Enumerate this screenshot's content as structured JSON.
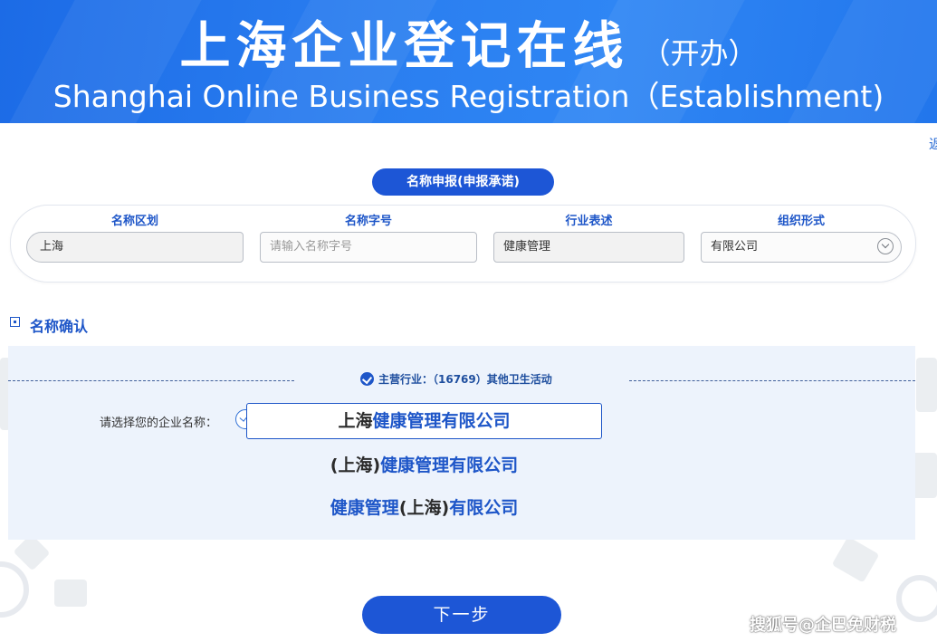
{
  "banner": {
    "title_cn": "上海企业登记在线",
    "title_cn_suffix": "（开办）",
    "title_en": "Shanghai Online Business Registration（Establishment)"
  },
  "edge_link": "返",
  "name_application": {
    "title": "名称申报(申报承诺)",
    "fields": [
      {
        "label": "名称区划",
        "value": "上海"
      },
      {
        "label": "名称字号",
        "placeholder": "请输入名称字号",
        "value": ""
      },
      {
        "label": "行业表述",
        "value": "健康管理"
      },
      {
        "label": "组织形式",
        "value": "有限公司"
      }
    ]
  },
  "name_confirm": {
    "title": "名称确认",
    "industry": "主营行业：（16769）其他卫生活动",
    "choose_label": "请选择您的企业名称：",
    "options": [
      {
        "parts": [
          {
            "text": "上海",
            "style": "dark"
          },
          {
            "text": "健康管理有限公司",
            "style": "blue"
          }
        ],
        "selected": true
      },
      {
        "parts": [
          {
            "text": "(上海)",
            "style": "dark"
          },
          {
            "text": "健康管理有限公司",
            "style": "blue"
          }
        ],
        "selected": false
      },
      {
        "parts": [
          {
            "text": "健康管理",
            "style": "blue"
          },
          {
            "text": "(上海)",
            "style": "dark"
          },
          {
            "text": "有限公司",
            "style": "blue"
          }
        ],
        "selected": false
      }
    ]
  },
  "next_button": "下一步",
  "watermark": "搜狐号@企巴免财税",
  "colors": {
    "primary": "#1d56d6",
    "banner": "#2a7ef0",
    "panel": "#edf3fc",
    "label_blue": "#1e56c8"
  }
}
